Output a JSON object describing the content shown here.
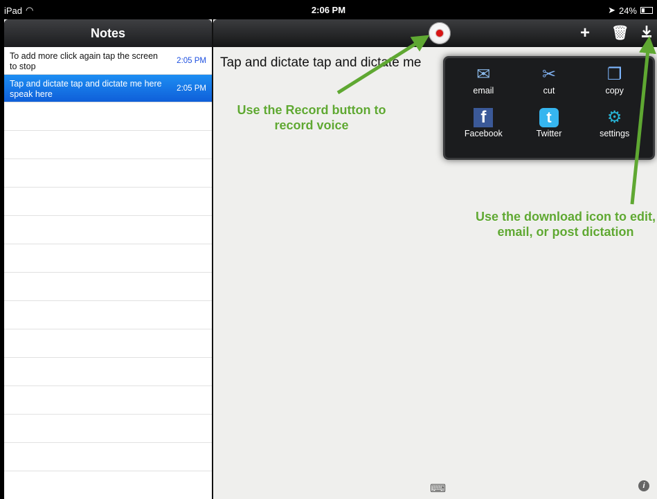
{
  "status_bar": {
    "device": "iPad",
    "time": "2:06 PM",
    "battery": "24%"
  },
  "notes_panel": {
    "title": "Notes",
    "items": [
      {
        "text": "To add more click again tap the screen to stop",
        "time": "2:05 PM"
      },
      {
        "text": "Tap and dictate tap and dictate me here speak here",
        "time": "2:05 PM",
        "selected": true
      }
    ]
  },
  "editor": {
    "note_text": "Tap and dictate tap and dictate me"
  },
  "share_menu": {
    "items": [
      {
        "label": "email",
        "icon": "mail-icon"
      },
      {
        "label": "cut",
        "icon": "scissors-icon"
      },
      {
        "label": "copy",
        "icon": "copy-icon"
      },
      {
        "label": "Facebook",
        "icon": "facebook-icon"
      },
      {
        "label": "Twitter",
        "icon": "twitter-icon"
      },
      {
        "label": "settings",
        "icon": "gear-icon"
      }
    ]
  },
  "annotations": {
    "record": "Use the Record button to record voice",
    "download": "Use the download icon to edit, email, or post dictation"
  },
  "colors": {
    "annotation_green": "#5fa832",
    "selection_blue": "#1d8ef3",
    "record_red": "#d91515"
  }
}
